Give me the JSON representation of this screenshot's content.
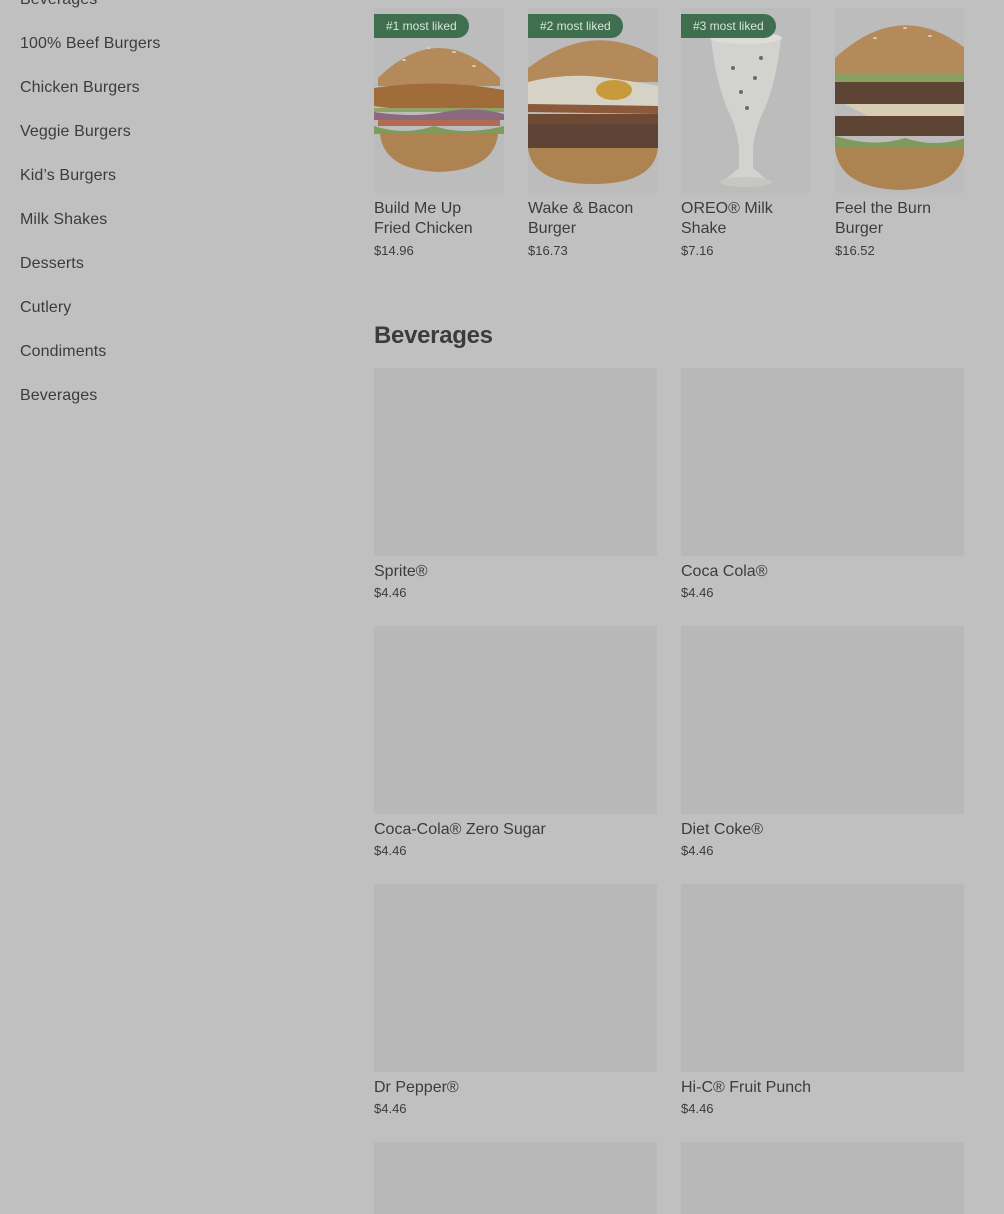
{
  "sidebar": {
    "items": [
      {
        "label": "Beverages"
      },
      {
        "label": "100% Beef Burgers"
      },
      {
        "label": "Chicken Burgers"
      },
      {
        "label": "Veggie Burgers"
      },
      {
        "label": "Kid’s Burgers"
      },
      {
        "label": "Milk Shakes"
      },
      {
        "label": "Desserts"
      },
      {
        "label": "Cutlery"
      },
      {
        "label": "Condiments"
      },
      {
        "label": "Beverages"
      }
    ]
  },
  "most_liked": [
    {
      "badge": "#1 most liked",
      "name": "Build Me Up Fried Chicken",
      "price": "$14.96"
    },
    {
      "badge": "#2 most liked",
      "name": "Wake & Bacon Burger",
      "price": "$16.73"
    },
    {
      "badge": "#3 most liked",
      "name": "OREO® Milk Shake",
      "price": "$7.16"
    },
    {
      "badge": "",
      "name": "Feel the Burn Burger",
      "price": "$16.52"
    }
  ],
  "beverages": {
    "title": "Beverages",
    "items": [
      {
        "name": "Sprite®",
        "price": "$4.46"
      },
      {
        "name": "Coca Cola®",
        "price": "$4.46"
      },
      {
        "name": "Coca-Cola® Zero Sugar",
        "price": "$4.46"
      },
      {
        "name": "Diet Coke®",
        "price": "$4.46"
      },
      {
        "name": "Dr Pepper®",
        "price": "$4.46"
      },
      {
        "name": "Hi-C® Fruit Punch",
        "price": "$4.46"
      },
      {
        "name": "",
        "price": ""
      },
      {
        "name": "",
        "price": ""
      }
    ]
  },
  "colors": {
    "overlay_bg": "#c0c0c0",
    "badge_bg": "#3f6f4e",
    "placeholder": "#b8b8b8"
  }
}
